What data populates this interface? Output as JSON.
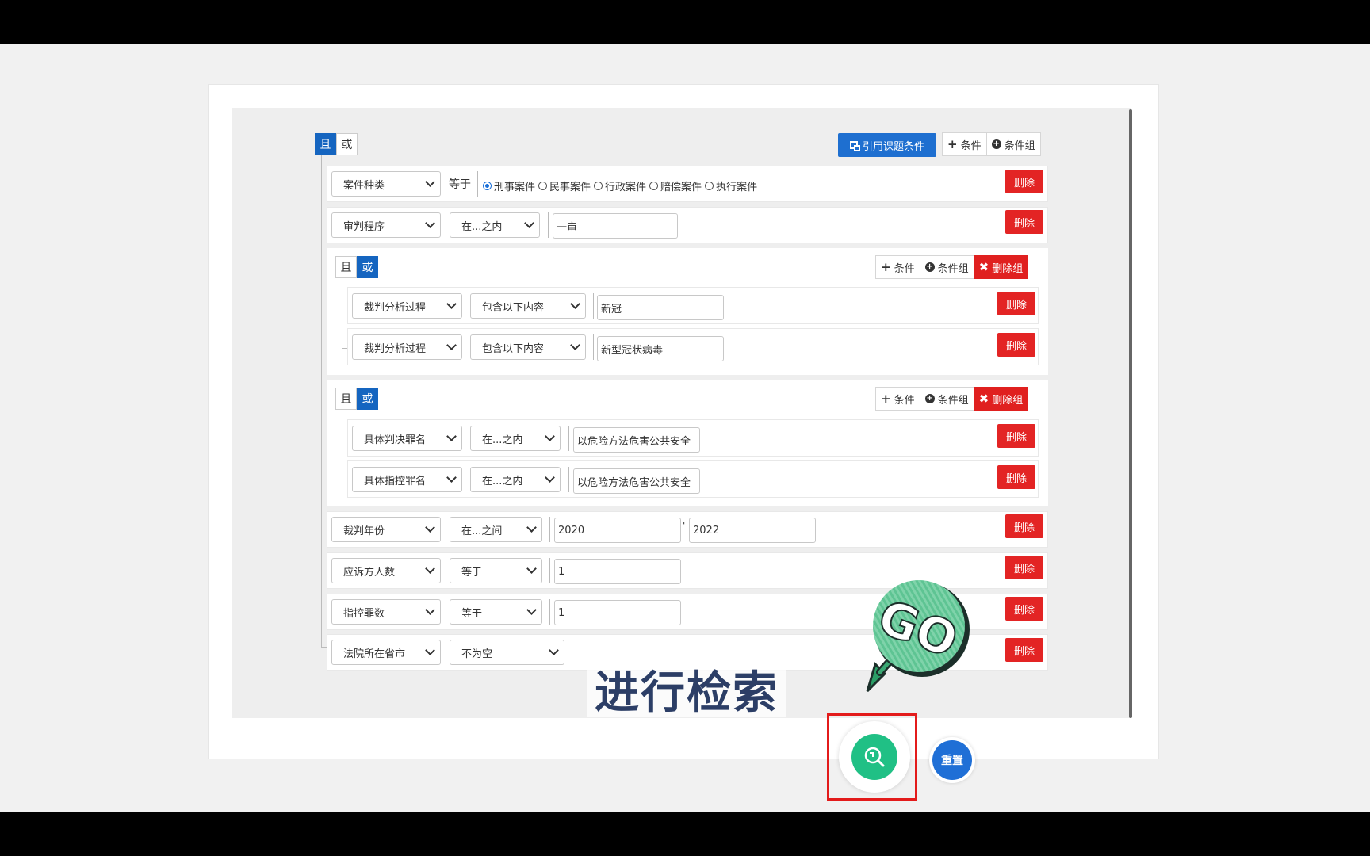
{
  "toolbar": {
    "and_label": "且",
    "or_label": "或",
    "cite_button": "引用课题条件",
    "add_condition": "条件",
    "add_group": "条件组"
  },
  "rows": {
    "case_type": {
      "field": "案件种类",
      "operator": "等于",
      "options": [
        "刑事案件",
        "民事案件",
        "行政案件",
        "赔偿案件",
        "执行案件"
      ],
      "selected": "刑事案件",
      "delete": "删除"
    },
    "procedure": {
      "field": "审判程序",
      "operator": "在...之内",
      "value": "一审",
      "delete": "删除"
    },
    "year": {
      "field": "裁判年份",
      "operator": "在...之间",
      "from": "2020",
      "separator": "'",
      "to": "2022",
      "delete": "删除"
    },
    "respondents": {
      "field": "应诉方人数",
      "operator": "等于",
      "value": "1",
      "delete": "删除"
    },
    "charges": {
      "field": "指控罪数",
      "operator": "等于",
      "value": "1",
      "delete": "删除"
    },
    "province": {
      "field": "法院所在省市",
      "operator": "不为空",
      "delete": "删除"
    }
  },
  "group1": {
    "and_label": "且",
    "or_label": "或",
    "add_condition": "条件",
    "add_group": "条件组",
    "delete_group": "删除组",
    "rows": [
      {
        "field": "裁判分析过程",
        "operator": "包含以下内容",
        "value": "新冠",
        "delete": "删除"
      },
      {
        "field": "裁判分析过程",
        "operator": "包含以下内容",
        "value": "新型冠状病毒",
        "delete": "删除"
      }
    ]
  },
  "group2": {
    "and_label": "且",
    "or_label": "或",
    "add_condition": "条件",
    "add_group": "条件组",
    "delete_group": "删除组",
    "rows": [
      {
        "field": "具体判决罪名",
        "operator": "在...之内",
        "value": "以危险方法危害公共安全",
        "delete": "删除"
      },
      {
        "field": "具体指控罪名",
        "operator": "在...之内",
        "value": "以危险方法危害公共安全",
        "delete": "删除"
      }
    ]
  },
  "overlay": {
    "caption": "进行检索",
    "sticker": "GO"
  },
  "actions": {
    "reset": "重置"
  },
  "colors": {
    "primary": "#1e6fd0",
    "danger": "#e32424",
    "search": "#20c085",
    "highlight": "#e31b1b"
  }
}
